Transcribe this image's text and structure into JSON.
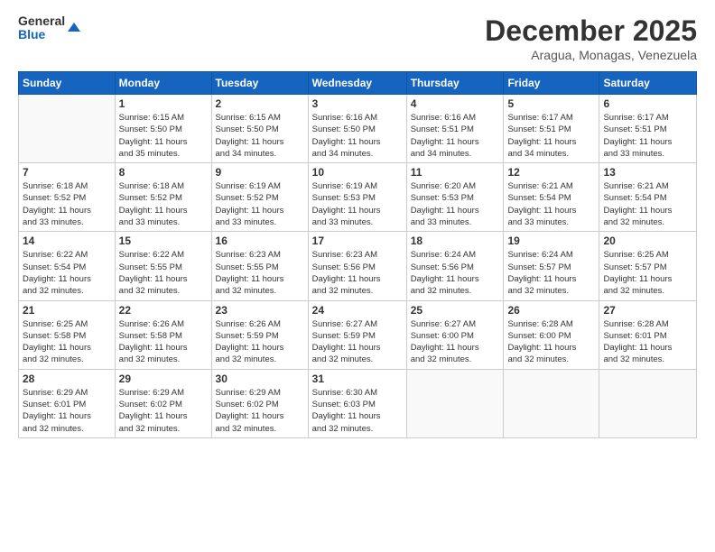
{
  "logo": {
    "line1": "General",
    "line2": "Blue"
  },
  "title": "December 2025",
  "subtitle": "Aragua, Monagas, Venezuela",
  "days_of_week": [
    "Sunday",
    "Monday",
    "Tuesday",
    "Wednesday",
    "Thursday",
    "Friday",
    "Saturday"
  ],
  "weeks": [
    [
      {
        "day": "",
        "info": ""
      },
      {
        "day": "1",
        "info": "Sunrise: 6:15 AM\nSunset: 5:50 PM\nDaylight: 11 hours\nand 35 minutes."
      },
      {
        "day": "2",
        "info": "Sunrise: 6:15 AM\nSunset: 5:50 PM\nDaylight: 11 hours\nand 34 minutes."
      },
      {
        "day": "3",
        "info": "Sunrise: 6:16 AM\nSunset: 5:50 PM\nDaylight: 11 hours\nand 34 minutes."
      },
      {
        "day": "4",
        "info": "Sunrise: 6:16 AM\nSunset: 5:51 PM\nDaylight: 11 hours\nand 34 minutes."
      },
      {
        "day": "5",
        "info": "Sunrise: 6:17 AM\nSunset: 5:51 PM\nDaylight: 11 hours\nand 34 minutes."
      },
      {
        "day": "6",
        "info": "Sunrise: 6:17 AM\nSunset: 5:51 PM\nDaylight: 11 hours\nand 33 minutes."
      }
    ],
    [
      {
        "day": "7",
        "info": "Sunrise: 6:18 AM\nSunset: 5:52 PM\nDaylight: 11 hours\nand 33 minutes."
      },
      {
        "day": "8",
        "info": "Sunrise: 6:18 AM\nSunset: 5:52 PM\nDaylight: 11 hours\nand 33 minutes."
      },
      {
        "day": "9",
        "info": "Sunrise: 6:19 AM\nSunset: 5:52 PM\nDaylight: 11 hours\nand 33 minutes."
      },
      {
        "day": "10",
        "info": "Sunrise: 6:19 AM\nSunset: 5:53 PM\nDaylight: 11 hours\nand 33 minutes."
      },
      {
        "day": "11",
        "info": "Sunrise: 6:20 AM\nSunset: 5:53 PM\nDaylight: 11 hours\nand 33 minutes."
      },
      {
        "day": "12",
        "info": "Sunrise: 6:21 AM\nSunset: 5:54 PM\nDaylight: 11 hours\nand 33 minutes."
      },
      {
        "day": "13",
        "info": "Sunrise: 6:21 AM\nSunset: 5:54 PM\nDaylight: 11 hours\nand 32 minutes."
      }
    ],
    [
      {
        "day": "14",
        "info": "Sunrise: 6:22 AM\nSunset: 5:54 PM\nDaylight: 11 hours\nand 32 minutes."
      },
      {
        "day": "15",
        "info": "Sunrise: 6:22 AM\nSunset: 5:55 PM\nDaylight: 11 hours\nand 32 minutes."
      },
      {
        "day": "16",
        "info": "Sunrise: 6:23 AM\nSunset: 5:55 PM\nDaylight: 11 hours\nand 32 minutes."
      },
      {
        "day": "17",
        "info": "Sunrise: 6:23 AM\nSunset: 5:56 PM\nDaylight: 11 hours\nand 32 minutes."
      },
      {
        "day": "18",
        "info": "Sunrise: 6:24 AM\nSunset: 5:56 PM\nDaylight: 11 hours\nand 32 minutes."
      },
      {
        "day": "19",
        "info": "Sunrise: 6:24 AM\nSunset: 5:57 PM\nDaylight: 11 hours\nand 32 minutes."
      },
      {
        "day": "20",
        "info": "Sunrise: 6:25 AM\nSunset: 5:57 PM\nDaylight: 11 hours\nand 32 minutes."
      }
    ],
    [
      {
        "day": "21",
        "info": "Sunrise: 6:25 AM\nSunset: 5:58 PM\nDaylight: 11 hours\nand 32 minutes."
      },
      {
        "day": "22",
        "info": "Sunrise: 6:26 AM\nSunset: 5:58 PM\nDaylight: 11 hours\nand 32 minutes."
      },
      {
        "day": "23",
        "info": "Sunrise: 6:26 AM\nSunset: 5:59 PM\nDaylight: 11 hours\nand 32 minutes."
      },
      {
        "day": "24",
        "info": "Sunrise: 6:27 AM\nSunset: 5:59 PM\nDaylight: 11 hours\nand 32 minutes."
      },
      {
        "day": "25",
        "info": "Sunrise: 6:27 AM\nSunset: 6:00 PM\nDaylight: 11 hours\nand 32 minutes."
      },
      {
        "day": "26",
        "info": "Sunrise: 6:28 AM\nSunset: 6:00 PM\nDaylight: 11 hours\nand 32 minutes."
      },
      {
        "day": "27",
        "info": "Sunrise: 6:28 AM\nSunset: 6:01 PM\nDaylight: 11 hours\nand 32 minutes."
      }
    ],
    [
      {
        "day": "28",
        "info": "Sunrise: 6:29 AM\nSunset: 6:01 PM\nDaylight: 11 hours\nand 32 minutes."
      },
      {
        "day": "29",
        "info": "Sunrise: 6:29 AM\nSunset: 6:02 PM\nDaylight: 11 hours\nand 32 minutes."
      },
      {
        "day": "30",
        "info": "Sunrise: 6:29 AM\nSunset: 6:02 PM\nDaylight: 11 hours\nand 32 minutes."
      },
      {
        "day": "31",
        "info": "Sunrise: 6:30 AM\nSunset: 6:03 PM\nDaylight: 11 hours\nand 32 minutes."
      },
      {
        "day": "",
        "info": ""
      },
      {
        "day": "",
        "info": ""
      },
      {
        "day": "",
        "info": ""
      }
    ]
  ]
}
